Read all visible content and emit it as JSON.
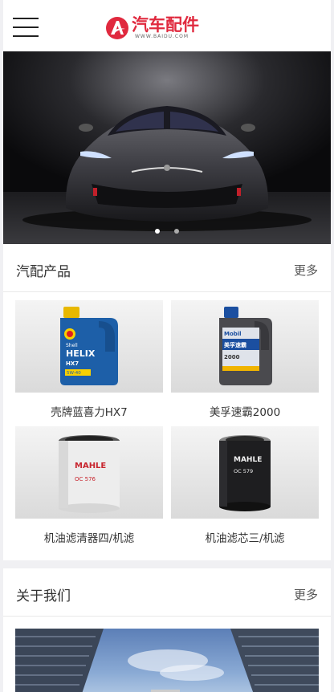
{
  "header": {
    "logo_title": "汽车配件",
    "logo_sub": "WWW.BAIDU.COM",
    "brand_color": "#e0293e"
  },
  "banner": {
    "slides": 2,
    "active_slide": 1
  },
  "products": {
    "title": "汽配产品",
    "more": "更多",
    "items": [
      {
        "label": "壳牌蓝喜力HX7",
        "image": "shell-helix-oil"
      },
      {
        "label": "美孚速霸2000",
        "image": "mobil-oil"
      },
      {
        "label": "机油滤清器四/机滤",
        "image": "mahle-oil-filter-white"
      },
      {
        "label": "机油滤芯三/机滤",
        "image": "mahle-oil-filter-black"
      }
    ],
    "bottle_texts": {
      "shell": "Shell",
      "helix": "HELIX",
      "hx7": "HX7",
      "shell_grade": "5W-40",
      "mobil": "Mobil",
      "mobil_cn": "美孚速霸",
      "mobil_model": "2000",
      "mahle1": "MAHLE",
      "oc1": "OC 576",
      "mahle2": "MAHLE",
      "oc2": "OC 579"
    }
  },
  "about": {
    "title": "关于我们",
    "more": "更多"
  }
}
